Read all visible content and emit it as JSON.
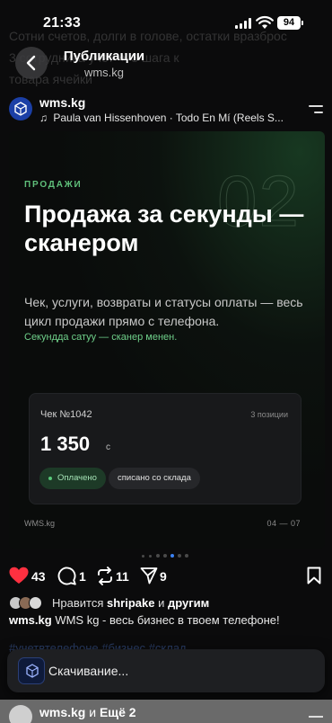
{
  "status_bar": {
    "time": "21:33",
    "battery": "94"
  },
  "background_text": [
    "Сотни счетов, долги в голове, остатки вразброс",
    "3 сотрудника учет ✦ 3 шага к",
    "товара ячейки"
  ],
  "nav": {
    "title": "Публикации",
    "subtitle": "wms.kg",
    "back_icon": "chevron-left-icon"
  },
  "post": {
    "account": "wms.kg",
    "music_icon": "music-note-icon",
    "music": "Paula van Hissenhoven · Todo En Mí (Reels S...",
    "menu_icon": "menu-lines-icon"
  },
  "slide": {
    "big_number": "02",
    "eyebrow": "ПРОДАЖИ",
    "headline": "Продажа за секунды — сканером",
    "description": "Чек, услуги, возвраты и статусы оплаты — весь цикл продажи прямо с телефона.",
    "green_note": "Секундда сатуу — сканер менен.",
    "card": {
      "label": "Чек №1042",
      "count": "3 позиции",
      "amount": "1 350",
      "currency": "с",
      "status_paid": "Оплачено",
      "status_stock": "списано со склада"
    },
    "brand": "WMS.kg",
    "page": "04 — 07",
    "accent": "#5fbf7a"
  },
  "carousel": {
    "dot_count": 7,
    "active_index": 4
  },
  "actions": {
    "likes": "43",
    "comments": "1",
    "reposts": "11",
    "shares": "9",
    "like_color": "#ff3040"
  },
  "likes_line": {
    "prefix": "Нравится",
    "user": "shripake",
    "middle": "и",
    "others": "другим"
  },
  "caption": {
    "account": "wms.kg",
    "text": "WMS kg - весь бизнес в твоем телефоне!"
  },
  "hashtags_faded": "#учетвтелефоне #бизнес #склад",
  "toast": {
    "text": "Скачивание..."
  },
  "next_post": {
    "account": "wms.kg",
    "conj": "и",
    "more": "Ещё 2"
  }
}
